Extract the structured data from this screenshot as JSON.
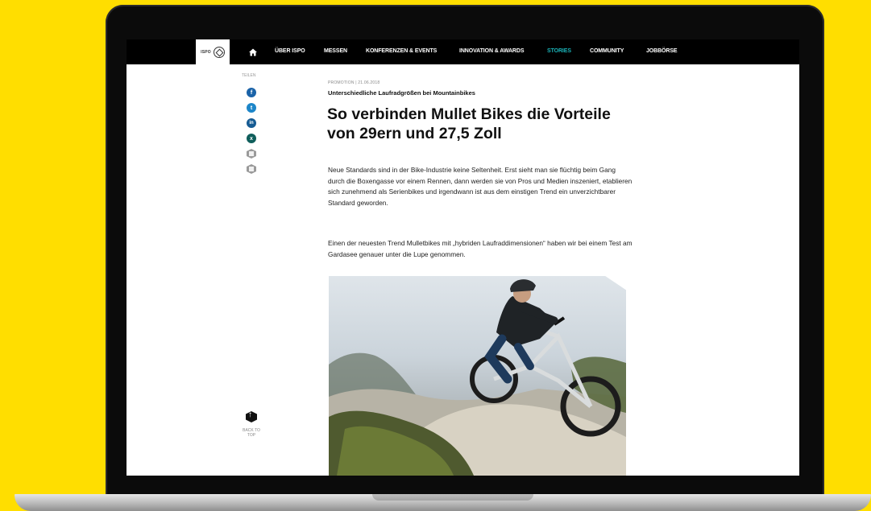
{
  "nav": {
    "logo": "ISPO",
    "items": [
      "ÜBER ISPO",
      "MESSEN",
      "KONFERENZEN & EVENTS",
      "INNOVATION & AWARDS",
      "STORIES",
      "COMMUNITY",
      "JOBBÖRSE"
    ],
    "active": "STORIES"
  },
  "share": {
    "label": "TEILEN",
    "networks": [
      {
        "name": "facebook",
        "glyph": "f",
        "color": "#1b63a8"
      },
      {
        "name": "twitter",
        "glyph": "t",
        "color": "#1d86c9"
      },
      {
        "name": "linkedin",
        "glyph": "in",
        "color": "#165b93"
      },
      {
        "name": "xing",
        "glyph": "x",
        "color": "#0f5e5b"
      }
    ],
    "back_to_top": "BACK TO TOP"
  },
  "article": {
    "meta": "PROMOTION | 21.06.2018",
    "kicker": "Unterschiedliche Laufradgrößen bei Mountainbikes",
    "title": "So verbinden Mullet Bikes die Vorteile von 29ern und 27,5 Zoll",
    "paragraph1": "Neue Standards sind in der Bike-Industrie keine Seltenheit. Erst sieht man sie flüchtig beim Gang durch die Boxengasse vor einem Rennen, dann werden sie von Pros und Medien inszeniert, etablieren sich zunehmend als Serienbikes und irgendwann ist aus dem einstigen Trend ein unverzichtbarer Standard geworden.",
    "paragraph2": "Einen der neuesten Trend Mulletbikes mit „hybriden Laufraddimensionen“ haben wir bei einem Test am Gardasee genauer unter die Lupe genommen."
  }
}
